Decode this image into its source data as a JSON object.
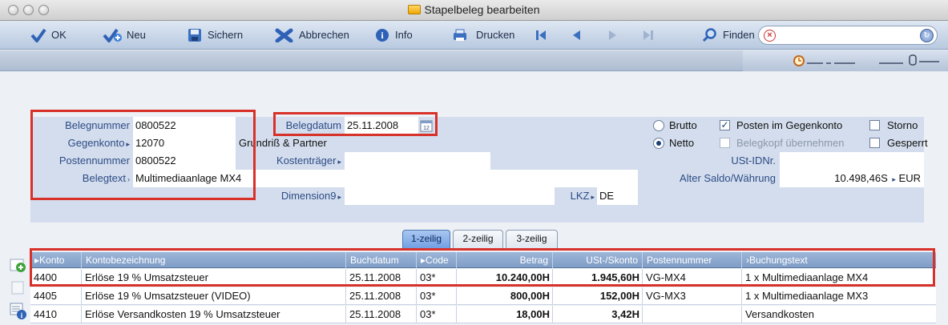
{
  "window": {
    "title": "Stapelbeleg bearbeiten"
  },
  "toolbar": {
    "ok": "OK",
    "neu": "Neu",
    "sichern": "Sichern",
    "abbrechen": "Abbrechen",
    "info": "Info",
    "drucken": "Drucken",
    "finden": "Finden",
    "find_value": ""
  },
  "form": {
    "belegnummer_label": "Belegnummer",
    "belegnummer": "0800522",
    "gegenkonto_label": "Gegenkonto",
    "gegenkonto": "12070",
    "gegenkonto_name": "Grundriß & Partner",
    "postennummer_label": "Postennummer",
    "postennummer": "0800522",
    "belegtext_label": "Belegtext",
    "belegtext": "Multimediaanlage MX4",
    "belegdatum_label": "Belegdatum",
    "belegdatum": "25.11.2008",
    "kostentraeger_label": "Kostenträger",
    "kostentraeger": "",
    "dimension9_label": "Dimension9",
    "dimension9": "",
    "lkz_label": "LKZ",
    "lkz": "DE",
    "ustid_label": "USt-IDNr.",
    "ustid": "",
    "alter_saldo_label": "Alter Saldo/Währung",
    "alter_saldo": "10.498,46S",
    "waehrung": "EUR",
    "brutto_label": "Brutto",
    "netto_label": "Netto",
    "posten_gegenkonto_label": "Posten im Gegenkonto",
    "belegkopf_label": "Belegkopf übernehmen",
    "storno_label": "Storno",
    "gesperrt_label": "Gesperrt",
    "netto_selected": true,
    "posten_gegenkonto_checked": true
  },
  "tabs": [
    "1-zeilig",
    "2-zeilig",
    "3-zeilig"
  ],
  "table": {
    "headers": [
      "Konto",
      "Kontobezeichnung",
      "Buchdatum",
      "Code",
      "Betrag",
      "USt-/Skonto",
      "Postennummer",
      "Buchungstext"
    ],
    "rows": [
      [
        "4400",
        "Erlöse 19 % Umsatzsteuer",
        "25.11.2008",
        "03*",
        "10.240,00H",
        "1.945,60H",
        "VG-MX4",
        "1 x Multimediaanlage MX4"
      ],
      [
        "4405",
        "Erlöse 19 % Umsatzsteuer (VIDEO)",
        "25.11.2008",
        "03*",
        "800,00H",
        "152,00H",
        "VG-MX3",
        "1 x Multimediaanlage MX3"
      ],
      [
        "4410",
        "Erlöse Versandkosten 19 % Umsatzsteuer",
        "25.11.2008",
        "03*",
        "18,00H",
        "3,42H",
        "",
        "Versandkosten"
      ]
    ]
  },
  "colors": {
    "highlight": "#d8312a",
    "label": "#2d4c86",
    "toolbar": "#b8c9e0"
  }
}
